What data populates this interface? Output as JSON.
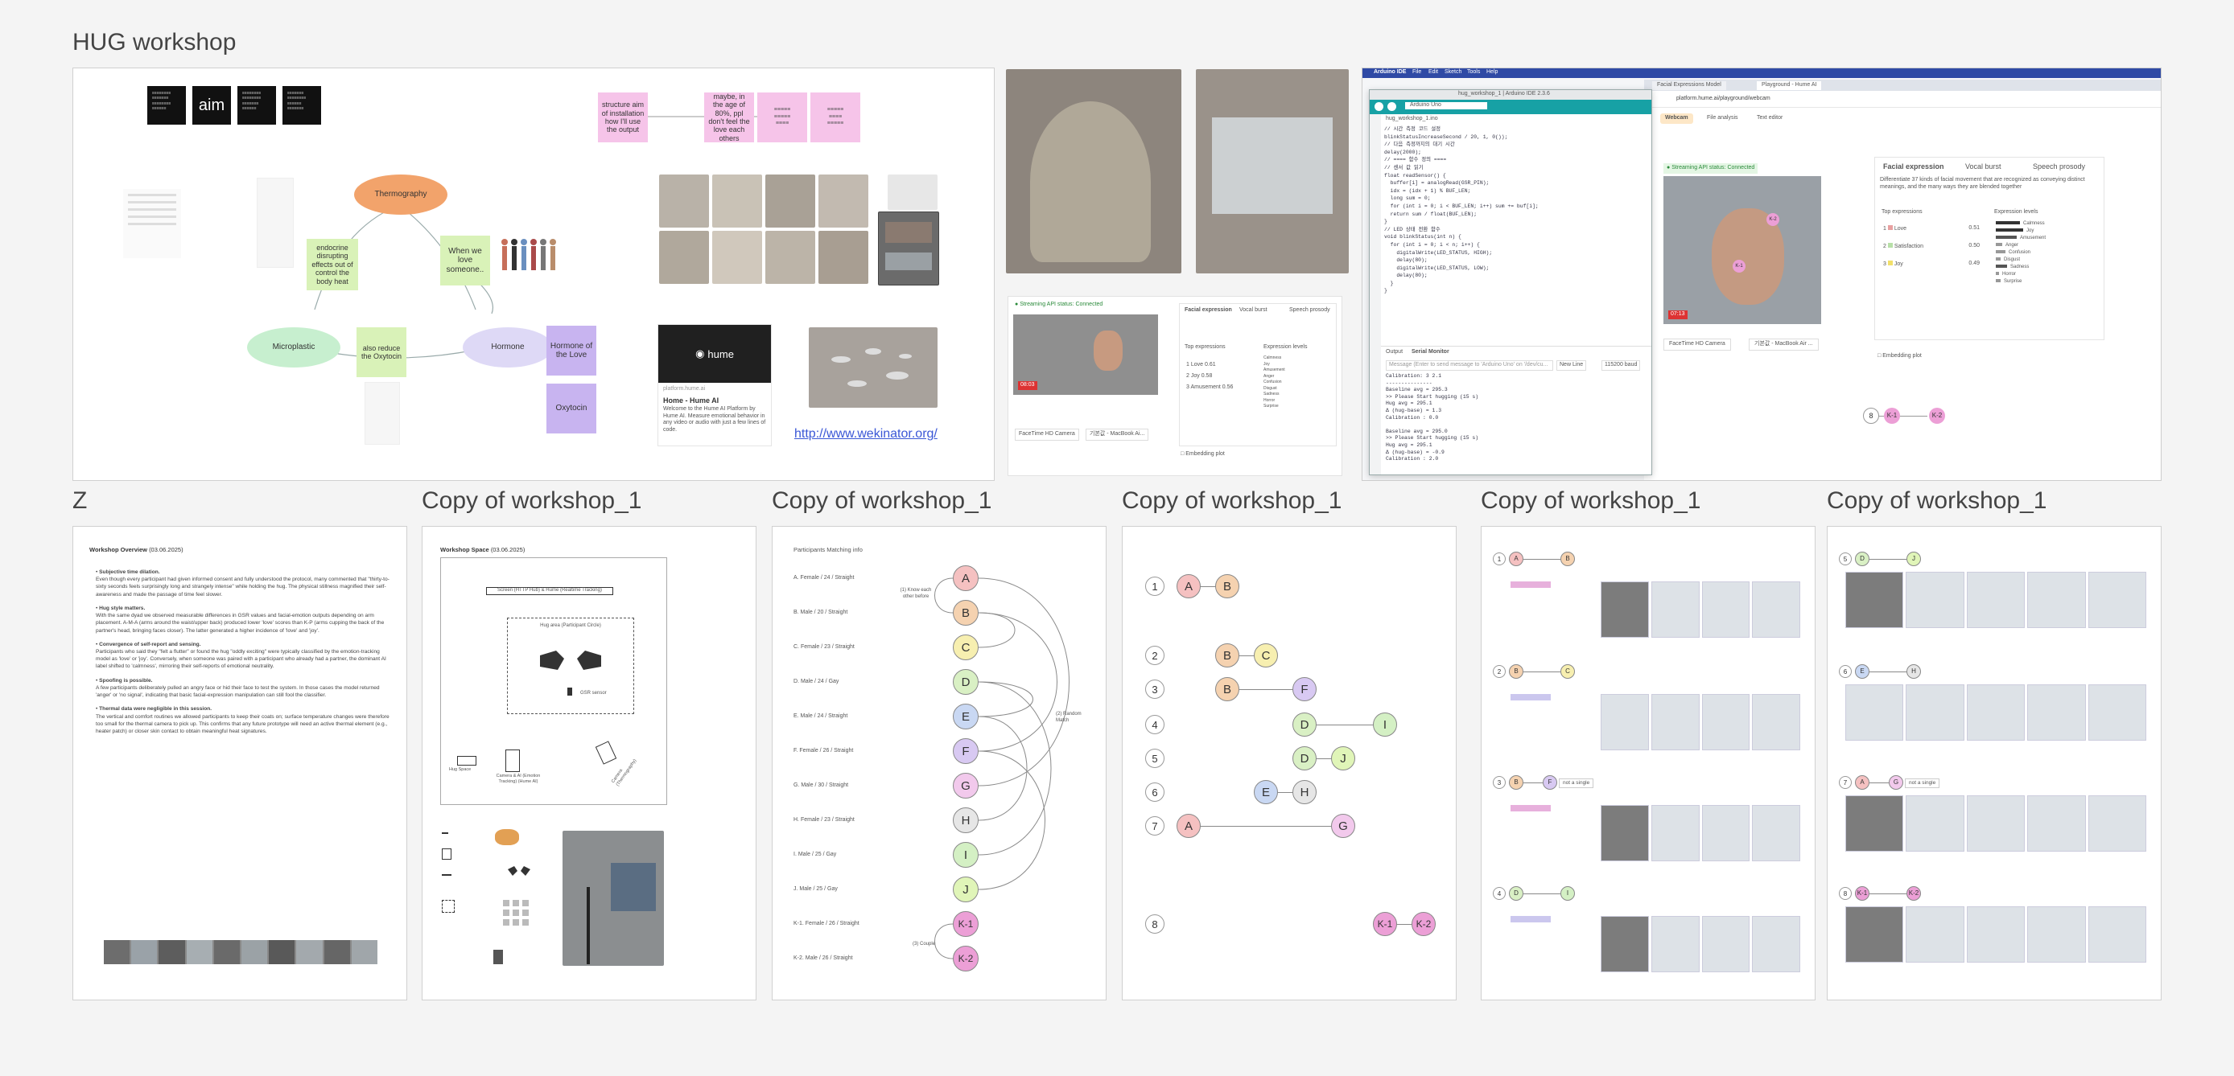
{
  "titles": {
    "main": "HUG workshop",
    "z": "Z",
    "copy1": "Copy of workshop_1",
    "copy2": "Copy of workshop_1",
    "copy3": "Copy of workshop_1",
    "copy4": "Copy of workshop_1",
    "copy5": "Copy of workshop_1"
  },
  "board": {
    "small_tiles": [
      "",
      "aim",
      "",
      ""
    ],
    "mindmap": {
      "thermography": "Thermography",
      "microplastic": "Microplastic",
      "hormone": "Hormone",
      "endocrine": "endocrine disrupting effects out of control the body heat",
      "also_reduce": "also reduce the Oxytocin",
      "when_we": "When we love someone..",
      "hormone_love": "Hormone of the Love",
      "oxytocin": "Oxytocin"
    },
    "stickies": [
      "structure aim of installation how I'll use the output",
      "maybe, in the age of 80%, ppl don't feel the love each others",
      "",
      ""
    ],
    "hume_card": {
      "logo": "hume",
      "site": "platform.hume.ai",
      "title": "Home - Hume AI",
      "desc": "Welcome to the Hume AI Platform by Hume AI. Measure emotional behavior in any video or audio with just a few lines of code."
    },
    "link": "http://www.wekinator.org/"
  },
  "stream_shot": {
    "status": "Streaming API status: Connected",
    "tabs": [
      "Facial expression",
      "Vocal burst",
      "Speech prosody"
    ],
    "top_label": "Top expressions",
    "levels_label": "Expression levels",
    "top": [
      {
        "rank": "1",
        "name": "Love",
        "score": "0.61"
      },
      {
        "rank": "2",
        "name": "Joy",
        "score": "0.58"
      },
      {
        "rank": "3",
        "name": "Amusement",
        "score": "0.56"
      }
    ],
    "levels": [
      "Calmness",
      "Joy",
      "Amusement",
      "Anger",
      "Confusion",
      "Disgust",
      "Sadness",
      "Horror",
      "Surprise"
    ],
    "camera": "FaceTime HD Camera",
    "mic": "기본값 - MacBook Ai...",
    "embedding": "Embedding plot",
    "timer": "08:03"
  },
  "arduino": {
    "menubar": [
      "Arduino IDE",
      "File",
      "Edit",
      "Sketch",
      "Tools",
      "Help"
    ],
    "window_title": "hug_workshop_1 | Arduino IDE 2.3.6",
    "board": "Arduino Uno",
    "tab": "hug_workshop_1.ino",
    "code": [
      "// 시간 측정 코드 설정",
      "blinkStatusIncreaseSecond / 20, 1, 0());",
      "",
      "// 다음 측정까지의 대기 시간",
      "delay(2000);",
      "",
      "// ==== 함수 정의 ====",
      "",
      "// 센서 값 읽기",
      "float readSensor() {",
      "  buffer[i] = analogRead(GSR_PIN);",
      "  idx = (idx + 1) % BUF_LEN;",
      "  long sum = 0;",
      "  for (int i = 0; i < BUF_LEN; i++) sum += buf[i];",
      "  return sum / float(BUF_LEN);",
      "}",
      "",
      "// LED 상태 전환 함수",
      "void blinkStatus(int n) {",
      "  for (int i = 0; i < n; i++) {",
      "    digitalWrite(LED_STATUS, HIGH);",
      "    delay(80);",
      "    digitalWrite(LED_STATUS, LOW);",
      "    delay(80);",
      "  }",
      "}"
    ],
    "monitor_tabs": [
      "Output",
      "Serial Monitor"
    ],
    "monitor_placeholder": "Message (Enter to send message to 'Arduino Uno' on '/dev/cu...",
    "line_ending": "New Line",
    "baud": "115200 baud",
    "serial": [
      "Calibration: 3 2.1",
      "---------------",
      "Baseline avg = 295.3",
      ">> Please Start hugging (15 s)",
      "Hug avg = 295.1",
      "Δ (hug-base) = 1.3",
      "Calibration : 0.0",
      "",
      "Baseline avg = 295.0",
      ">> Please Start hugging (15 s)",
      "Hug avg = 295.1",
      "Δ (hug-base) = -0.9",
      "Calibration : 2.0"
    ]
  },
  "browser": {
    "tabs": [
      "Facial Expressions Model",
      "Playground - Hume AI"
    ],
    "url": "platform.hume.ai/playground/webcam",
    "mode_tabs": [
      "Webcam",
      "File analysis",
      "Text editor"
    ],
    "status": "Streaming API status: Connected",
    "fe_tabs": [
      "Facial expression",
      "Vocal burst",
      "Speech prosody"
    ],
    "desc": "Differentiate 37 kinds of facial movement that are recognized as conveying distinct meanings, and the many ways they are blended together",
    "top_label": "Top expressions",
    "levels_label": "Expression levels",
    "top": [
      {
        "rank": "1",
        "name": "Love",
        "score": "0.51",
        "color": "#e8a0a0"
      },
      {
        "rank": "2",
        "name": "Satisfaction",
        "score": "0.50",
        "color": "#b8e0a8"
      },
      {
        "rank": "3",
        "name": "Joy",
        "score": "0.49",
        "color": "#f2e06a"
      }
    ],
    "levels": [
      "Calmness",
      "Joy",
      "Amusement",
      "Anger",
      "Confusion",
      "Disgust",
      "Sadness",
      "Horror",
      "Surprise"
    ],
    "camera": "FaceTime HD Camera",
    "mic": "기본값 - MacBook Air ...",
    "embedding": "Embedding plot",
    "timer": "07:13",
    "k1": "K-1",
    "k2": "K-2",
    "chain": [
      "8",
      "K-1",
      "K-2"
    ]
  },
  "z_doc": {
    "heading": "Workshop Overview",
    "date": "(03.06.2025)",
    "items": [
      {
        "title": "Subjective time dilation.",
        "text": "Even though every participant had given informed consent and fully understood the protocol, many commented that \"thirty-to-sixty seconds feels surprisingly long and strangely intense\" while holding the hug. The physical stillness magnified their self-awareness and made the passage of time feel slower."
      },
      {
        "title": "Hug style matters.",
        "text": "With the same dyad we observed measurable differences in GSR values and facial-emotion outputs depending on arm placement. A-M-A (arms around the waist/upper back) produced lower 'love' scores than K-P (arms cupping the back of the partner's head, bringing faces closer). The latter generated a higher incidence of 'love' and 'joy'."
      },
      {
        "title": "Convergence of self-report and sensing.",
        "text": "Participants who said they \"felt a flutter\" or found the hug \"oddly exciting\" were typically classified by the emotion-tracking model as 'love' or 'joy'. Conversely, when someone was paired with a participant who already had a partner, the dominant AI label shifted to 'calmness', mirroring their self-reports of emotional neutrality."
      },
      {
        "title": "Spoofing is possible.",
        "text": "A few participants deliberately pulled an angry face or hid their face to test the system. In those cases the model returned 'anger' or 'no signal', indicating that basic facial-expression manipulation can still fool the classifier."
      },
      {
        "title": "Thermal data were negligible in this session.",
        "text": "The vertical and comfort routines we allowed participants to keep their coats on; surface temperature changes were therefore too small for the thermal camera to pick up. This confirms that any future prototype will need an active thermal element (e.g., heater patch) or closer skin contact to obtain meaningful heat signatures."
      }
    ]
  },
  "c1_doc": {
    "heading": "Workshop Space",
    "date": "(03.06.2025)",
    "screen_label": "Screen (HTTP Hub) & Hume (Realtime Tracking)",
    "hug_area": "Hug area (Participant Circle)",
    "gsr": "GSR sensor",
    "hug_space": "Hug Space",
    "camera_lbl": "Camera & AI (Emotion Tracking) (Hume AI)",
    "camera2_lbl": "Camera (Thermography)"
  },
  "c2_list": {
    "heading": "Participants Matching info",
    "participants": [
      {
        "label": "A. Female / 24 / Straight",
        "node": "A",
        "color": "#f5c1c1"
      },
      {
        "label": "B. Male / 20 / Straight",
        "node": "B",
        "color": "#f5d2b0"
      },
      {
        "label": "C. Female / 23 / Straight",
        "node": "C",
        "color": "#f7efb0"
      },
      {
        "label": "D. Male / 24 / Gay",
        "node": "D",
        "color": "#d9f0c4"
      },
      {
        "label": "E. Male / 24 / Straight",
        "node": "E",
        "color": "#c9d8f3"
      },
      {
        "label": "F. Female / 26 / Straight",
        "node": "F",
        "color": "#d8c9f2"
      },
      {
        "label": "G. Male / 30 / Straight",
        "node": "G",
        "color": "#f2c9ec"
      },
      {
        "label": "H. Female / 23 / Straight",
        "node": "H",
        "color": "#e6e6e6"
      },
      {
        "label": "I. Male / 25 / Gay",
        "node": "I",
        "color": "#d4f0c4"
      },
      {
        "label": "J. Male / 25 / Gay",
        "node": "J",
        "color": "#e0f5b8"
      },
      {
        "label": "K-1. Female / 26 / Straight",
        "node": "K-1",
        "color": "#ec9fd6"
      },
      {
        "label": "K-2. Male / 26 / Straight",
        "node": "K-2",
        "color": "#ec9fd6"
      }
    ],
    "note_know": "(1) Know each other before",
    "note_random": "(2) Random Match",
    "note_couple": "(3) Couple"
  },
  "c3_pairs": {
    "rows": [
      {
        "num": "1",
        "nodes": [
          {
            "t": "A",
            "c": "#f5c1c1"
          },
          {
            "t": "B",
            "c": "#f5d2b0"
          }
        ]
      },
      {
        "num": "2",
        "nodes": [
          {
            "t": "B",
            "c": "#f5d2b0"
          },
          {
            "t": "C",
            "c": "#f7efb0"
          }
        ]
      },
      {
        "num": "3",
        "nodes": [
          {
            "t": "B",
            "c": "#f5d2b0"
          },
          {
            "t": "F",
            "c": "#d8c9f2"
          }
        ]
      },
      {
        "num": "4",
        "nodes": [
          {
            "t": "D",
            "c": "#d9f0c4"
          },
          {
            "t": "I",
            "c": "#d4f0c4"
          }
        ]
      },
      {
        "num": "5",
        "nodes": [
          {
            "t": "D",
            "c": "#d9f0c4"
          },
          {
            "t": "J",
            "c": "#e0f5b8"
          }
        ]
      },
      {
        "num": "6",
        "nodes": [
          {
            "t": "E",
            "c": "#c9d8f3"
          },
          {
            "t": "H",
            "c": "#e6e6e6"
          }
        ]
      },
      {
        "num": "7",
        "nodes": [
          {
            "t": "A",
            "c": "#f5c1c1"
          },
          {
            "t": "G",
            "c": "#f2c9ec"
          }
        ]
      },
      {
        "num": "8",
        "nodes": [
          {
            "t": "K-1",
            "c": "#ec9fd6"
          },
          {
            "t": "K-2",
            "c": "#ec9fd6"
          }
        ]
      }
    ]
  },
  "c4_rows": [
    {
      "num": "1",
      "a": "A",
      "ac": "#f5c1c1",
      "b": "B",
      "bc": "#f5d2b0",
      "tag": ""
    },
    {
      "num": "2",
      "a": "B",
      "ac": "#f5d2b0",
      "b": "C",
      "bc": "#f7efb0",
      "tag": ""
    },
    {
      "num": "3",
      "a": "B",
      "ac": "#f5d2b0",
      "b": "F",
      "bc": "#d8c9f2",
      "tag": "not a single"
    },
    {
      "num": "4",
      "a": "D",
      "ac": "#d9f0c4",
      "b": "I",
      "bc": "#d4f0c4",
      "tag": ""
    }
  ],
  "c5_rows": [
    {
      "num": "5",
      "a": "D",
      "ac": "#d9f0c4",
      "b": "J",
      "bc": "#e0f5b8",
      "tag": ""
    },
    {
      "num": "6",
      "a": "E",
      "ac": "#c9d8f3",
      "b": "H",
      "bc": "#e6e6e6",
      "tag": ""
    },
    {
      "num": "7",
      "a": "A",
      "ac": "#f5c1c1",
      "b": "G",
      "bc": "#f2c9ec",
      "tag": "not a single"
    },
    {
      "num": "8",
      "a": "K-1",
      "ac": "#ec9fd6",
      "b": "K-2",
      "bc": "#ec9fd6",
      "tag": ""
    }
  ]
}
